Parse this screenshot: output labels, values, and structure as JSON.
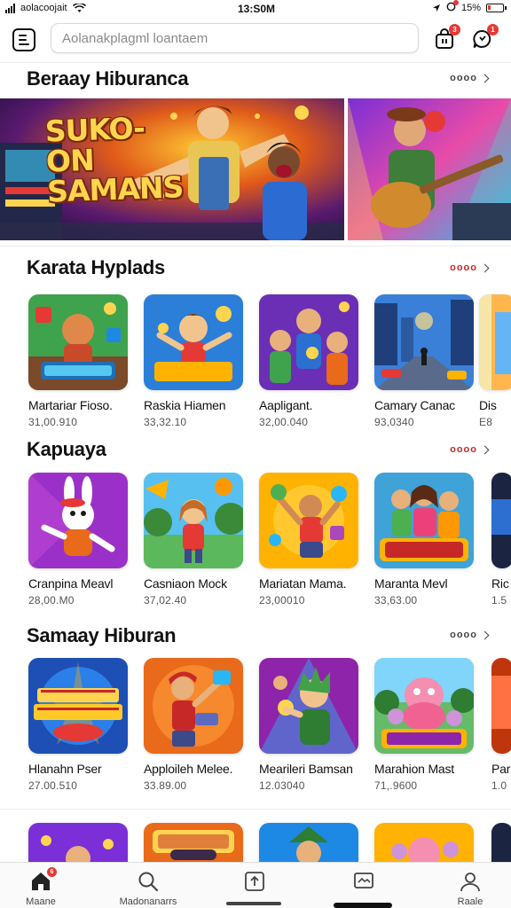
{
  "status_bar": {
    "carrier": "aolacoojait",
    "time": "13:S0M",
    "battery": "15%"
  },
  "search": {
    "placeholder": "Aolanakplagml loantaem"
  },
  "header": {
    "cart_badge": "3",
    "chat_badge": "1"
  },
  "featured": {
    "title": "Beraay Hiburanca",
    "see_more": "oooo",
    "banner_text": "SUKO-ON SAMANS"
  },
  "sections": [
    {
      "title": "Karata Hyplads",
      "see_more": "oooo",
      "items": [
        {
          "name": "Martariar Fioso.",
          "meta": "31,00.910",
          "thumb": "puzzle-jungle"
        },
        {
          "name": "Raskia Hiamen",
          "meta": "33,32.10",
          "thumb": "kid-gold"
        },
        {
          "name": "Aapligant.",
          "meta": "32,00.040",
          "thumb": "friends"
        },
        {
          "name": "Camary Canac",
          "meta": "93,0340",
          "thumb": "city-street"
        },
        {
          "name": "Dis",
          "meta": "E8",
          "thumb": "partial"
        }
      ]
    },
    {
      "title": "Kapuaya",
      "see_more": "oooo",
      "items": [
        {
          "name": "Cranpina Meavl",
          "meta": "28,00.M0",
          "thumb": "bunny"
        },
        {
          "name": "Casniaon Mock",
          "meta": "37,02.40",
          "thumb": "girl-park"
        },
        {
          "name": "Mariatan Mama.",
          "meta": "23,00010",
          "thumb": "juggler"
        },
        {
          "name": "Maranta Mevl",
          "meta": "33,63.00",
          "thumb": "game-crew"
        },
        {
          "name": "Ric",
          "meta": "1.5",
          "thumb": "partial-dark"
        }
      ]
    },
    {
      "title": "Samaay Hiburan",
      "see_more": "oooo",
      "items": [
        {
          "name": "Hlanahn Pser",
          "meta": "27.00.510",
          "thumb": "arcade-logo"
        },
        {
          "name": "Apploileh Melee.",
          "meta": "33.89.00",
          "thumb": "gamer-girl"
        },
        {
          "name": "Mearileri Bamsan",
          "meta": "12.03040",
          "thumb": "green-hair"
        },
        {
          "name": "Marahion Mast",
          "meta": "71,.9600",
          "thumb": "pink-monster"
        },
        {
          "name": "Par",
          "meta": "1.0",
          "thumb": "partial-warm"
        }
      ]
    }
  ],
  "bottom_row_thumbs": [
    "cheer",
    "logo-orange",
    "elf",
    "pink-creature",
    "partial-dark"
  ],
  "bottom_nav": [
    {
      "label": "Maane",
      "icon": "home-icon",
      "badge": "6"
    },
    {
      "label": "Madonanarrs",
      "icon": "search-icon"
    },
    {
      "label": "",
      "icon": "share-icon"
    },
    {
      "label": "",
      "icon": "media-icon"
    },
    {
      "label": "Raale",
      "icon": "profile-icon"
    }
  ],
  "colors": {
    "accent": "#e53935",
    "text": "#111111",
    "muted": "#555555"
  }
}
